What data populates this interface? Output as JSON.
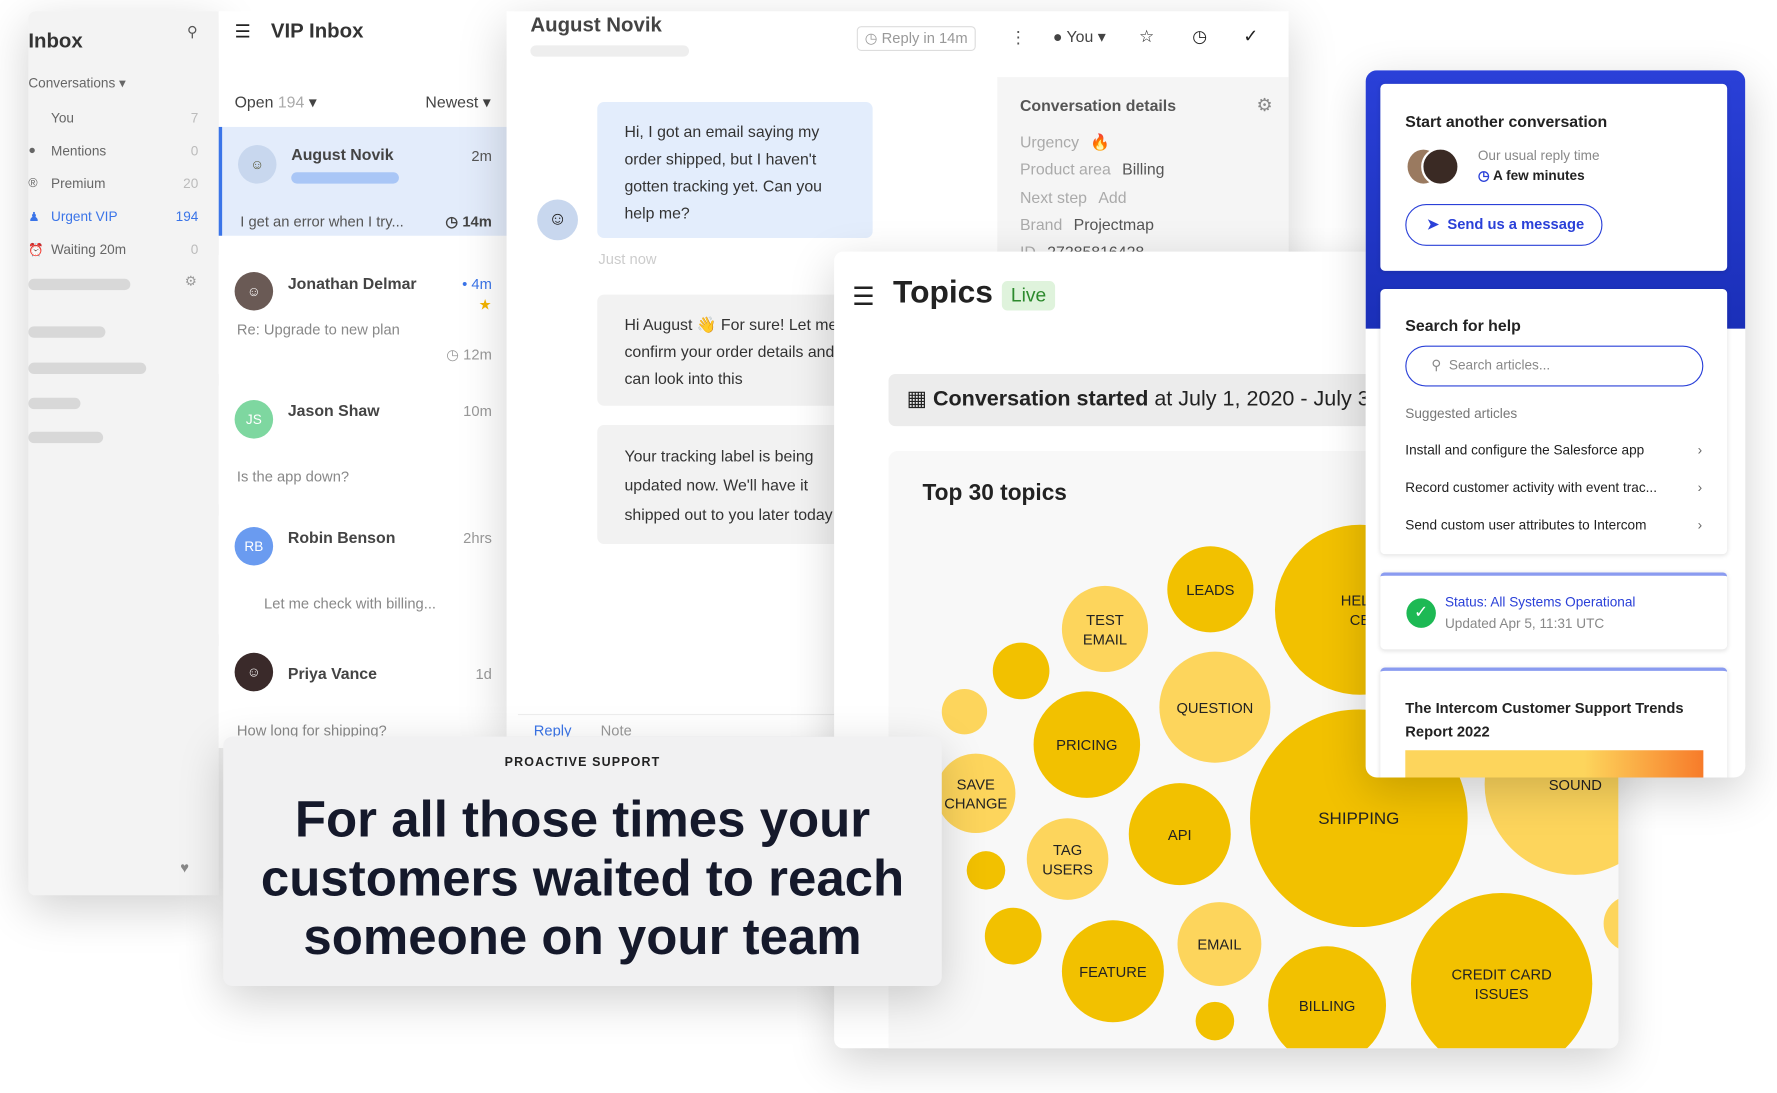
{
  "sidebar": {
    "title": "Inbox",
    "section": "Conversations",
    "items": [
      {
        "label": "You",
        "count": "7",
        "icon": "none"
      },
      {
        "label": "Mentions",
        "count": "0",
        "icon": "avatar"
      },
      {
        "label": "Premium",
        "count": "20",
        "icon": "premium-icon"
      },
      {
        "label": "Urgent VIP",
        "count": "194",
        "icon": "team-icon"
      },
      {
        "label": "Waiting 20m",
        "count": "0",
        "icon": "alarm-icon"
      }
    ]
  },
  "list": {
    "title": "VIP Inbox",
    "filter": "Open",
    "filter_count": "194",
    "sort": "Newest",
    "items": [
      {
        "name": "August Novik",
        "time": "2m",
        "preview": "I get an error when I try...",
        "sla": "14m",
        "selected": true
      },
      {
        "name": "Jonathan Delmar",
        "time": "4m",
        "preview": "Re: Upgrade to new plan",
        "sla": "12m"
      },
      {
        "name": "Jason Shaw",
        "initials": "JS",
        "time": "10m",
        "preview": "Is the app down?"
      },
      {
        "name": "Robin Benson",
        "initials": "RB",
        "time": "2hrs",
        "preview": "Let me check with billing..."
      },
      {
        "name": "Priya Vance",
        "time": "1d",
        "preview": "How long for shipping?"
      }
    ]
  },
  "conversation": {
    "title": "August Novik",
    "reply_timer": "Reply in 14m",
    "assignee": "You",
    "messages": [
      "Hi, I got an email saying my order shipped, but I haven't gotten tracking yet. Can you help me?",
      "Hi August 👋 For sure! Let me confirm your order details and can look into this",
      "Your tracking label is being updated now. We'll have it shipped out to you later today"
    ],
    "timestamp": "Just now",
    "tabs": [
      "Reply",
      "Note"
    ]
  },
  "details": {
    "title": "Conversation details",
    "rows": [
      {
        "label": "Urgency",
        "value": "🔥"
      },
      {
        "label": "Product area",
        "value": "Billing"
      },
      {
        "label": "Next step",
        "value": "Add"
      },
      {
        "label": "Brand",
        "value": "Projectmap"
      },
      {
        "label": "ID",
        "value": "27285816428"
      }
    ]
  },
  "topics": {
    "title": "Topics",
    "badge": "Live",
    "date_bold": "Conversation started",
    "date_rest": "at July 1, 2020 - July 3",
    "chart_title": "Top 30 topics"
  },
  "chart_data": {
    "type": "bubble",
    "title": "Top 30 topics",
    "colors": {
      "dark": "#f2c100",
      "light": "#fdd55c"
    },
    "bubbles": [
      {
        "label": "TEST EMAIL",
        "value": 38,
        "shade": "light"
      },
      {
        "label": "LEADS",
        "value": 38,
        "shade": "dark"
      },
      {
        "label": "HELP CE",
        "value": 75,
        "shade": "dark"
      },
      {
        "label": "",
        "value": 25,
        "shade": "dark"
      },
      {
        "label": "",
        "value": 20,
        "shade": "light"
      },
      {
        "label": "QUESTION",
        "value": 49,
        "shade": "light"
      },
      {
        "label": "PRICING",
        "value": 47,
        "shade": "dark"
      },
      {
        "label": "SAVE CHANGE",
        "value": 35,
        "shade": "light"
      },
      {
        "label": "SHIPPING",
        "value": 96,
        "shade": "dark"
      },
      {
        "label": "SOUND",
        "value": 80,
        "shade": "light"
      },
      {
        "label": "API",
        "value": 45,
        "shade": "dark"
      },
      {
        "label": "TAG USERS",
        "value": 36,
        "shade": "light"
      },
      {
        "label": "",
        "value": 17,
        "shade": "dark"
      },
      {
        "label": "",
        "value": 25,
        "shade": "dark"
      },
      {
        "label": "EMAIL",
        "value": 37,
        "shade": "light"
      },
      {
        "label": "FEATURE",
        "value": 45,
        "shade": "dark"
      },
      {
        "label": "",
        "value": 17,
        "shade": "dark"
      },
      {
        "label": "BILLING",
        "value": 52,
        "shade": "dark"
      },
      {
        "label": "CREDIT CARD ISSUES",
        "value": 80,
        "shade": "dark"
      },
      {
        "label": "",
        "value": 25,
        "shade": "light"
      }
    ]
  },
  "messenger": {
    "accent": "#1f36c7",
    "start_title": "Start another conversation",
    "reply_label": "Our usual reply time",
    "reply_value": "A few minutes",
    "send_button": "Send us a message",
    "search_title": "Search for help",
    "search_placeholder": "Search articles...",
    "suggested_label": "Suggested articles",
    "articles": [
      "Install and configure the Salesforce app",
      "Record customer activity with event trac...",
      "Send custom user attributes to Intercom"
    ],
    "status": "Status: All Systems Operational",
    "status_updated": "Updated Apr 5, 11:31 UTC",
    "report_title": "The Intercom Customer Support Trends Report 2022"
  },
  "promo": {
    "eyebrow": "PROACTIVE SUPPORT",
    "headline": "For all those times your customers waited to reach someone on your team"
  }
}
